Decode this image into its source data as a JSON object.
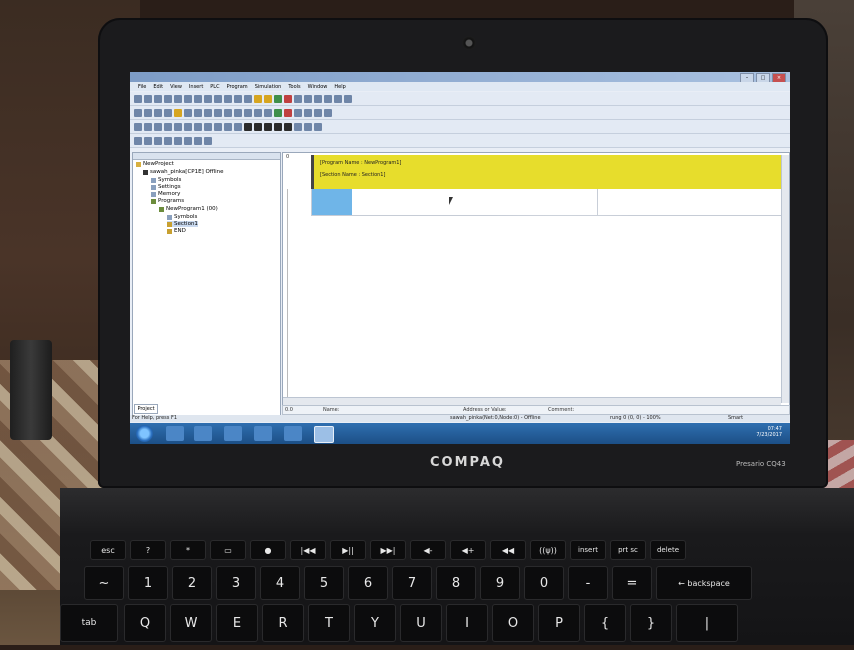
{
  "menu": {
    "items": [
      "File",
      "Edit",
      "View",
      "Insert",
      "PLC",
      "Program",
      "Simulation",
      "Tools",
      "Window",
      "Help"
    ]
  },
  "tree": {
    "root": "NewProject",
    "plc": "sawah_pinka[CP1E] Offline",
    "symbols": "Symbols",
    "settings": "Settings",
    "memory": "Memory",
    "programs": "Programs",
    "program1": "NewProgram1 (00)",
    "p_symbols": "Symbols",
    "section1": "Section1",
    "end": "END",
    "tab": "Project"
  },
  "ladder": {
    "rung_number": "0",
    "program_name": "[Program Name : NewProgram1]",
    "section_name": "[Section Name : Section1]"
  },
  "infobar": {
    "zero": "0.0",
    "name": "Name:",
    "address": "Address or Value:",
    "comment": "Comment:"
  },
  "status": {
    "help": "For Help, press F1",
    "plc": "sawah_pinka(Net:0,Node:0) - Offline",
    "rung": "rung 0 (0, 0) - 100%",
    "mode": "Smart"
  },
  "tray": {
    "time": "07:47",
    "date": "7/23/2017"
  },
  "laptop": {
    "brand": "COMPAQ",
    "model": "Presario CQ43"
  },
  "keyboard": {
    "row1": [
      "esc",
      "?",
      "*",
      "▭",
      "●",
      "|◀◀",
      "▶||",
      "▶▶|",
      "◀-",
      "◀+",
      "◀◀",
      "((ψ))",
      "insert",
      "prt sc",
      "delete"
    ],
    "row2": [
      "~",
      "!",
      "@",
      "#",
      "$",
      "%",
      "^",
      "&",
      "*",
      "(",
      ")",
      "_",
      "+",
      "← backspace"
    ],
    "row2sub": [
      "`",
      "1",
      "2",
      "3",
      "4",
      "5",
      "6",
      "7",
      "8",
      "9",
      "0",
      "-",
      "="
    ],
    "row3": [
      "tab",
      "Q",
      "W",
      "E",
      "R",
      "T",
      "Y",
      "U",
      "I",
      "O",
      "P",
      "{",
      "}",
      "|"
    ]
  }
}
